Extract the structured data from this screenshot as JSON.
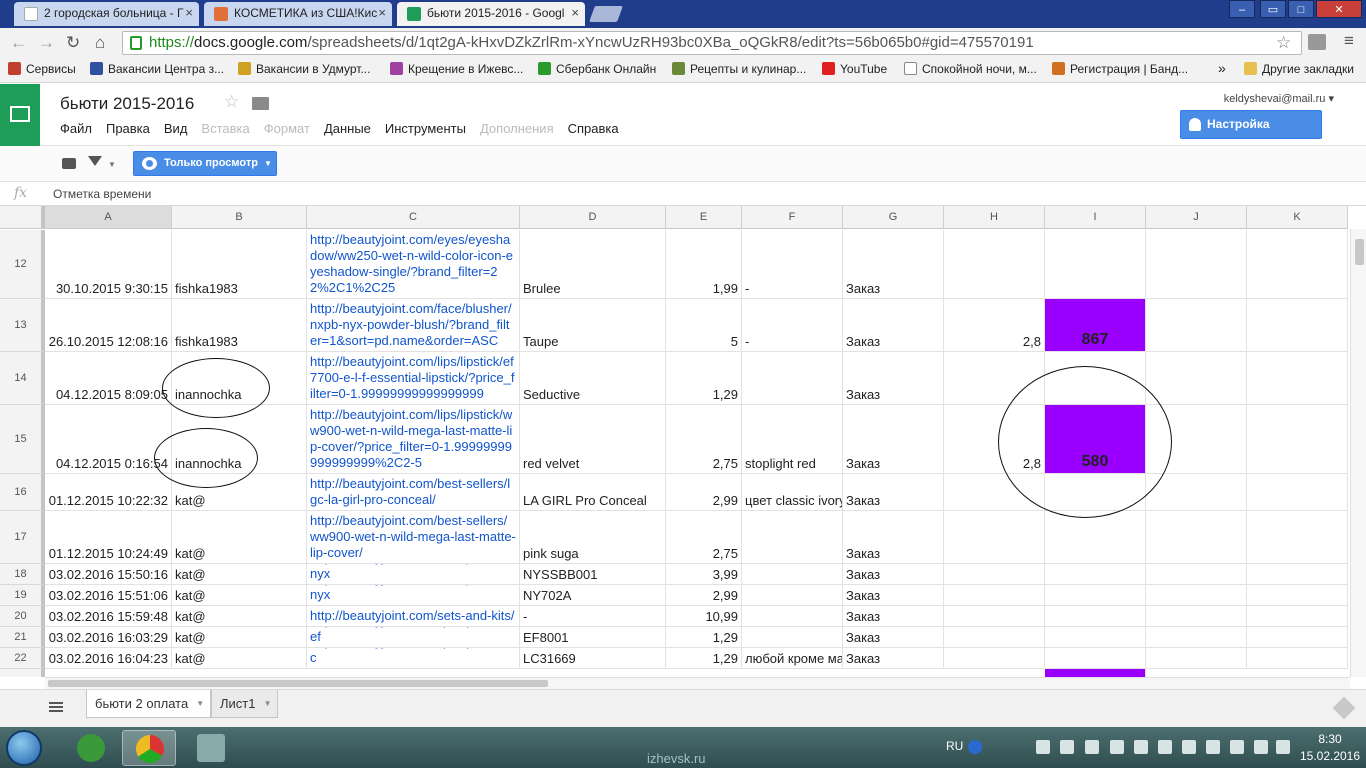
{
  "browser": {
    "tabs": [
      {
        "label": "2 городская больница - Г",
        "fav_color": "#ffffff"
      },
      {
        "label": "КОСМЕТИКА из США!Кис",
        "fav_color": "#e0703a"
      },
      {
        "label": "бьюти 2015-2016 - Googl",
        "fav_color": "#1e9d58"
      }
    ],
    "close_glyph": "×",
    "url": {
      "scheme": "https://",
      "host": "docs.google.com",
      "path": "/spreadsheets/d/1qt2gA-kHxvDZkZrlRm-xYncwUzRH93bc0XBa_oQGkR8/edit?ts=56b065b0#gid=475570191"
    },
    "bookmarks": [
      {
        "label": "Сервисы",
        "color": "#c04030"
      },
      {
        "label": "Вакансии Центра з...",
        "color": "#3050a0"
      },
      {
        "label": "Вакансии в Удмурт...",
        "color": "#d0a020"
      },
      {
        "label": "Крещение в Ижевс...",
        "color": "#a040a0"
      },
      {
        "label": "Сбербанк Онлайн",
        "color": "#2a9a2a"
      },
      {
        "label": "Рецепты и кулинар...",
        "color": "#6a8a3a"
      },
      {
        "label": "YouTube",
        "color": "#e02020"
      },
      {
        "label": "Спокойной ночи, м...",
        "color": "#ffffff"
      },
      {
        "label": "Регистрация | Банд...",
        "color": "#d07020"
      }
    ],
    "bookmarks_more": "»",
    "other_bookmarks": "Другие закладки"
  },
  "sheets": {
    "title": "бьюти 2015-2016",
    "menu": [
      {
        "label": "Файл",
        "disabled": false
      },
      {
        "label": "Правка",
        "disabled": false
      },
      {
        "label": "Вид",
        "disabled": false
      },
      {
        "label": "Вставка",
        "disabled": true
      },
      {
        "label": "Формат",
        "disabled": true
      },
      {
        "label": "Данные",
        "disabled": false
      },
      {
        "label": "Инструменты",
        "disabled": false
      },
      {
        "label": "Дополнения",
        "disabled": true
      },
      {
        "label": "Справка",
        "disabled": false
      }
    ],
    "account": "keldyshevai@mail.ru",
    "share_label": "Настройка доступа",
    "view_only_label": "Только просмотр",
    "formula_symbol": "fx",
    "formula_text": "Отметка времени",
    "columns": [
      "A",
      "B",
      "C",
      "D",
      "E",
      "F",
      "G",
      "H",
      "I",
      "J",
      "K"
    ],
    "rows": [
      {
        "num": "12",
        "a": "30.10.2015 9:30:15",
        "b": "fishka1983",
        "c": "http://beautyjoint.com/eyes/eyeshadow/ww250-wet-n-wild-color-icon-eyeshadow-single/?brand_filter=22%2C1%2C25",
        "d": "Brulee",
        "e": "1,99",
        "f": "-",
        "g": "Заказ",
        "h": "",
        "i": ""
      },
      {
        "num": "13",
        "a": "26.10.2015 12:08:16",
        "b": "fishka1983",
        "c": "http://beautyjoint.com/face/blusher/nxpb-nyx-powder-blush/?brand_filter=1&sort=pd.name&order=ASC",
        "d": "Taupe",
        "e": "5",
        "f": "-",
        "g": "Заказ",
        "h": "2,8",
        "i": "867"
      },
      {
        "num": "14",
        "a": "04.12.2015 8:09:05",
        "b": "inannochka",
        "c": "http://beautyjoint.com/lips/lipstick/ef7700-e-l-f-essential-lipstick/?price_filter=0-1.99999999999999999",
        "d": "Seductive",
        "e": "1,29",
        "f": "",
        "g": "Заказ",
        "h": "",
        "i": ""
      },
      {
        "num": "15",
        "a": "04.12.2015 0:16:54",
        "b": "inannochka",
        "c": "http://beautyjoint.com/lips/lipstick/ww900-wet-n-wild-mega-last-matte-lip-cover/?price_filter=0-1.99999999999999999%2C2-5",
        "d": "red velvet",
        "e": "2,75",
        "f": "stoplight red",
        "g": "Заказ",
        "h": "2,8",
        "i": "580"
      },
      {
        "num": "16",
        "a": "01.12.2015 10:22:32",
        "b": "kat@",
        "c": "http://beautyjoint.com/best-sellers/lgc-la-girl-pro-conceal/",
        "d": "LA GIRL Pro Conceal",
        "e": "2,99",
        "f": "цвет classic ivory",
        "g": "Заказ",
        "h": "",
        "i": ""
      },
      {
        "num": "17",
        "a": "01.12.2015 10:24:49",
        "b": "kat@",
        "c": "http://beautyjoint.com/best-sellers/ww900-wet-n-wild-mega-last-matte-lip-cover/",
        "d": "pink suga",
        "e": "2,75",
        "f": "",
        "g": "Заказ",
        "h": "",
        "i": ""
      },
      {
        "num": "18",
        "a": "03.02.2016 15:50:16",
        "b": "kat@",
        "c": "http://beautyjoint.com/face/powder/nyx",
        "d": "NYSSBB001",
        "e": "3,99",
        "f": "",
        "g": "Заказ",
        "h": "",
        "i": ""
      },
      {
        "num": "19",
        "a": "03.02.2016 15:51:06",
        "b": "kat@",
        "c": "http://beautyjoint.com/face/powder/nyx",
        "d": "NY702A",
        "e": "2,99",
        "f": "",
        "g": "Заказ",
        "h": "",
        "i": ""
      },
      {
        "num": "20",
        "a": "03.02.2016 15:59:48",
        "b": "kat@",
        "c": "http://beautyjoint.com/sets-and-kits/",
        "d": "-",
        "e": "10,99",
        "f": "",
        "g": "Заказ",
        "h": "",
        "i": ""
      },
      {
        "num": "21",
        "a": "03.02.2016 16:03:29",
        "b": "kat@",
        "c": "http://beautyjoint.com/lips/lip-balm/ef",
        "d": "EF8001",
        "e": "1,29",
        "f": "",
        "g": "Заказ",
        "h": "",
        "i": ""
      },
      {
        "num": "22",
        "a": "03.02.2016 16:04:23",
        "b": "kat@",
        "c": "http://beautyjoint.com/lips/lip-balm/lc",
        "d": "LC31669",
        "e": "1,29",
        "f": "любой кроме ма",
        "g": "Заказ",
        "h": "",
        "i": ""
      }
    ],
    "highlight_color": "#9900ff",
    "sheet_tabs": [
      {
        "label": "бьюти 2 оплата",
        "active": true
      },
      {
        "label": "Лист1",
        "active": false
      }
    ]
  },
  "taskbar": {
    "watermark": "izhevsk.ru",
    "lang": "RU",
    "time": "8:30",
    "date": "15.02.2016"
  }
}
